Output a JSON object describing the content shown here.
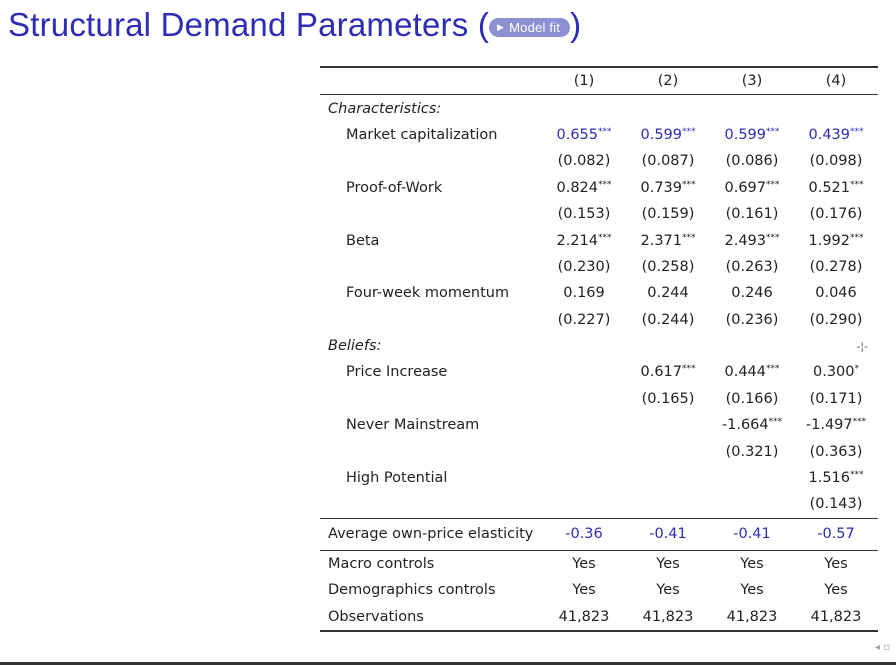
{
  "title": {
    "text": "Structural Demand Parameters",
    "open_paren": "(",
    "close_paren": ")",
    "button_label": "Model fit"
  },
  "table": {
    "headers": [
      "(1)",
      "(2)",
      "(3)",
      "(4)"
    ],
    "sections": {
      "characteristics": "Characteristics:",
      "beliefs": "Beliefs:"
    },
    "rows": {
      "market_cap": {
        "label": "Market capitalization",
        "c1": "0.655",
        "c2": "0.599",
        "c3": "0.599",
        "c4": "0.439",
        "s1": "***",
        "s2": "***",
        "s3": "***",
        "s4": "***",
        "se1": "(0.082)",
        "se2": "(0.087)",
        "se3": "(0.086)",
        "se4": "(0.098)"
      },
      "pow": {
        "label": "Proof-of-Work",
        "c1": "0.824",
        "c2": "0.739",
        "c3": "0.697",
        "c4": "0.521",
        "s1": "***",
        "s2": "***",
        "s3": "***",
        "s4": "***",
        "se1": "(0.153)",
        "se2": "(0.159)",
        "se3": "(0.161)",
        "se4": "(0.176)"
      },
      "beta": {
        "label": "Beta",
        "c1": "2.214",
        "c2": "2.371",
        "c3": "2.493",
        "c4": "1.992",
        "s1": "***",
        "s2": "***",
        "s3": "***",
        "s4": "***",
        "se1": "(0.230)",
        "se2": "(0.258)",
        "se3": "(0.263)",
        "se4": "(0.278)"
      },
      "momentum": {
        "label": "Four-week momentum",
        "c1": "0.169",
        "c2": "0.244",
        "c3": "0.246",
        "c4": "0.046",
        "se1": "(0.227)",
        "se2": "(0.244)",
        "se3": "(0.236)",
        "se4": "(0.290)"
      },
      "price_increase": {
        "label": "Price Increase",
        "c2": "0.617",
        "c3": "0.444",
        "c4": "0.300",
        "s2": "***",
        "s3": "***",
        "s4": "*",
        "se2": "(0.165)",
        "se3": "(0.166)",
        "se4": "(0.171)"
      },
      "never_mainstream": {
        "label": "Never Mainstream",
        "c3": "-1.664",
        "c4": "-1.497",
        "s3": "***",
        "s4": "***",
        "se3": "(0.321)",
        "se4": "(0.363)"
      },
      "high_potential": {
        "label": "High Potential",
        "c4": "1.516",
        "s4": "***",
        "se4": "(0.143)"
      }
    },
    "beliefs_marker": "-¦-",
    "elasticity": {
      "label": "Average own-price elasticity",
      "c1": "-0.36",
      "c2": "-0.41",
      "c3": "-0.41",
      "c4": "-0.57"
    },
    "footer": {
      "macro": {
        "label": "Macro controls",
        "c1": "Yes",
        "c2": "Yes",
        "c3": "Yes",
        "c4": "Yes"
      },
      "demo": {
        "label": "Demographics controls",
        "c1": "Yes",
        "c2": "Yes",
        "c3": "Yes",
        "c4": "Yes"
      },
      "obs": {
        "label": "Observations",
        "c1": "41,823",
        "c2": "41,823",
        "c3": "41,823",
        "c4": "41,823"
      }
    }
  },
  "nav": {
    "icons": [
      "nav-left-arrow",
      "nav-frame"
    ]
  },
  "colors": {
    "title": "#2c2cb5",
    "highlight": "#2c2cb5",
    "button_bg": "#8e90d4"
  }
}
